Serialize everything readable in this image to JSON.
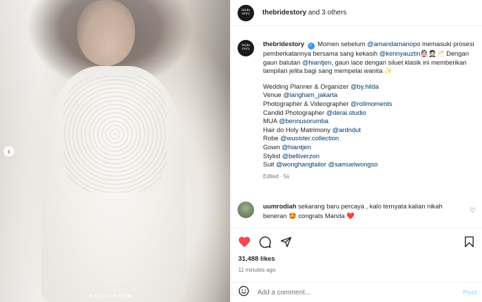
{
  "account": {
    "username": "thebridestory",
    "header_suffix": "and 3 others",
    "avatar_text": [
      "bride",
      "story"
    ]
  },
  "caption": {
    "username": "thebridestory",
    "intro_part1": "Momen sebelum",
    "mention_bride": "@amandamanopo",
    "intro_part2": "memasuki prosesi pemberkatannya bersama sang kekasih",
    "mention_groom": "@kennyauztin",
    "emoji_1": "👰🏻🤵🏻🥂",
    "intro_part3": "Dengan gaun balutan",
    "mention_gown": "@hiantjen",
    "intro_part4": ", gaun lace dengan siluet klasik ini memberikan tampilan jelita bagi sang mempelai wanita",
    "emoji_2": "✨",
    "credits": [
      {
        "label": "Wedding Planner & Organizer",
        "handle": "@by.hilda"
      },
      {
        "label": "Venue",
        "handle": "@langham_jakarta"
      },
      {
        "label": "Photographer & Videographer",
        "handle": "@rollmoments"
      },
      {
        "label": "Candid Photographer",
        "handle": "@derai.studio"
      },
      {
        "label": "MUA",
        "handle": "@bennusorumba"
      },
      {
        "label": "Hair do Holy Matrimony",
        "handle": "@ardndut"
      },
      {
        "label": "Robe",
        "handle": "@wusister.collection"
      },
      {
        "label": "Gown",
        "handle": "@hiantjen"
      },
      {
        "label": "Stylist",
        "handle": "@belliverzon"
      },
      {
        "label": "Suit",
        "handle": "@wonghangtailor @samuelwongso"
      }
    ],
    "edited": "Edited · 5s"
  },
  "comment": {
    "username": "uumrodiah",
    "text": "sekarang baru percaya , kalo ternyata kalian nikah beneran",
    "emoji": "🤩",
    "text2": "congrats Manda",
    "emoji2": "❤️"
  },
  "stats": {
    "likes": "31,488 likes",
    "time": "11 minutes ago"
  },
  "input": {
    "placeholder": "Add a comment...",
    "post_label": "Post"
  },
  "carousel": {
    "dot_count": 9,
    "active_index": 8
  },
  "colors": {
    "like_red": "#ed4956",
    "mention_blue": "#00376b",
    "verified_blue": "#3897f0",
    "post_disabled": "#b2dffc"
  },
  "icons": [
    "heart-filled-icon",
    "comment-icon",
    "share-icon",
    "bookmark-icon",
    "emoji-icon",
    "chevron-left-icon",
    "verified-icon"
  ]
}
